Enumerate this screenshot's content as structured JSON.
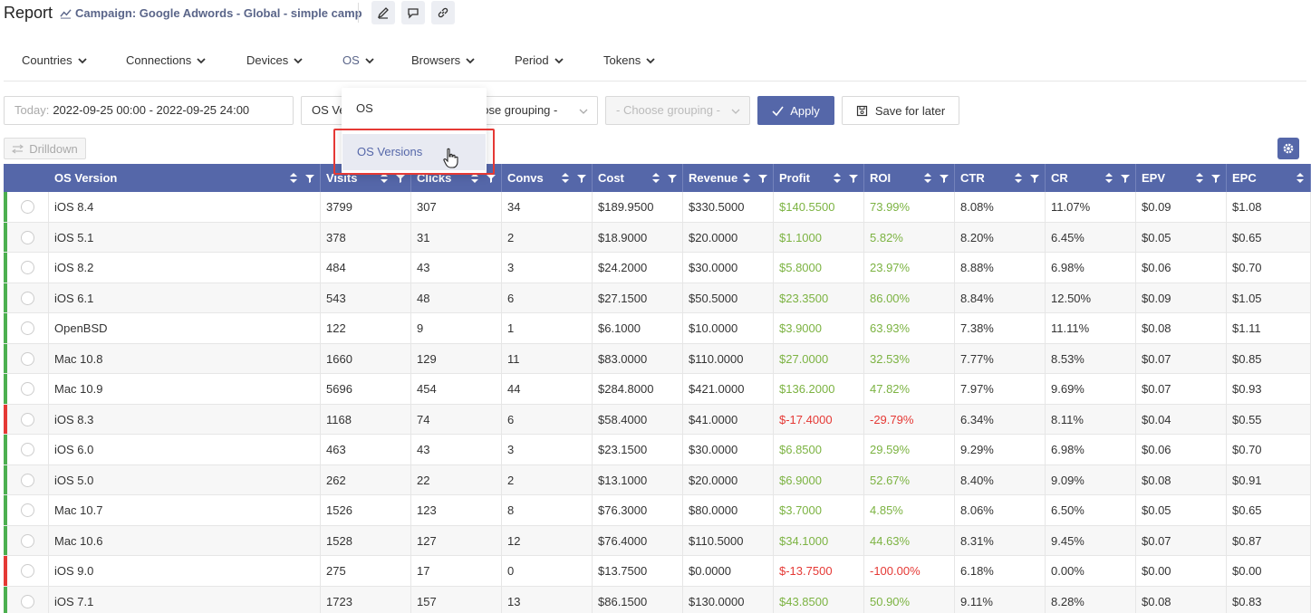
{
  "header": {
    "title": "Report",
    "campaign": "Campaign: Google Adwords - Global - simple camp",
    "buttons": [
      "edit-icon",
      "comment-icon",
      "link-icon"
    ]
  },
  "tabs": [
    {
      "label": "Countries",
      "active": false
    },
    {
      "label": "Connections",
      "active": false
    },
    {
      "label": "Devices",
      "active": false
    },
    {
      "label": "OS",
      "active": true
    },
    {
      "label": "Browsers",
      "active": false
    },
    {
      "label": "Period",
      "active": false
    },
    {
      "label": "Tokens",
      "active": false
    }
  ],
  "filters": {
    "date_label": "Today:",
    "date_value": "2022-09-25 00:00 - 2022-09-25 24:00",
    "grouping1": "OS Ve",
    "grouping2": "oose grouping -",
    "grouping3": "- Choose grouping -",
    "apply_label": "Apply",
    "save_label": "Save for later",
    "drilldown_label": "Drilldown"
  },
  "dropdown": {
    "items": [
      "OS",
      "OS Versions"
    ],
    "hovered": "OS Versions"
  },
  "table": {
    "columns": [
      "OS Version",
      "Visits",
      "Clicks",
      "Convs",
      "Cost",
      "Revenue",
      "Profit",
      "ROI",
      "CTR",
      "CR",
      "EPV",
      "EPC"
    ],
    "rows": [
      {
        "status": "green",
        "cells": [
          "iOS 8.4",
          "3799",
          "307",
          "34",
          "$189.9500",
          "$330.5000",
          "$140.5500",
          "73.99%",
          "8.08%",
          "11.07%",
          "$0.09",
          "$1.08"
        ]
      },
      {
        "status": "green",
        "cells": [
          "iOS 5.1",
          "378",
          "31",
          "2",
          "$18.9000",
          "$20.0000",
          "$1.1000",
          "5.82%",
          "8.20%",
          "6.45%",
          "$0.05",
          "$0.65"
        ]
      },
      {
        "status": "green",
        "cells": [
          "iOS 8.2",
          "484",
          "43",
          "3",
          "$24.2000",
          "$30.0000",
          "$5.8000",
          "23.97%",
          "8.88%",
          "6.98%",
          "$0.06",
          "$0.70"
        ]
      },
      {
        "status": "green",
        "cells": [
          "iOS 6.1",
          "543",
          "48",
          "6",
          "$27.1500",
          "$50.5000",
          "$23.3500",
          "86.00%",
          "8.84%",
          "12.50%",
          "$0.09",
          "$1.05"
        ]
      },
      {
        "status": "green",
        "cells": [
          "OpenBSD",
          "122",
          "9",
          "1",
          "$6.1000",
          "$10.0000",
          "$3.9000",
          "63.93%",
          "7.38%",
          "11.11%",
          "$0.08",
          "$1.11"
        ]
      },
      {
        "status": "green",
        "cells": [
          "Mac 10.8",
          "1660",
          "129",
          "11",
          "$83.0000",
          "$110.0000",
          "$27.0000",
          "32.53%",
          "7.77%",
          "8.53%",
          "$0.07",
          "$0.85"
        ]
      },
      {
        "status": "green",
        "cells": [
          "Mac 10.9",
          "5696",
          "454",
          "44",
          "$284.8000",
          "$421.0000",
          "$136.2000",
          "47.82%",
          "7.97%",
          "9.69%",
          "$0.07",
          "$0.93"
        ]
      },
      {
        "status": "red",
        "cells": [
          "iOS 8.3",
          "1168",
          "74",
          "6",
          "$58.4000",
          "$41.0000",
          "$-17.4000",
          "-29.79%",
          "6.34%",
          "8.11%",
          "$0.04",
          "$0.55"
        ]
      },
      {
        "status": "green",
        "cells": [
          "iOS 6.0",
          "463",
          "43",
          "3",
          "$23.1500",
          "$30.0000",
          "$6.8500",
          "29.59%",
          "9.29%",
          "6.98%",
          "$0.06",
          "$0.70"
        ]
      },
      {
        "status": "green",
        "cells": [
          "iOS 5.0",
          "262",
          "22",
          "2",
          "$13.1000",
          "$20.0000",
          "$6.9000",
          "52.67%",
          "8.40%",
          "9.09%",
          "$0.08",
          "$0.91"
        ]
      },
      {
        "status": "green",
        "cells": [
          "Mac 10.7",
          "1526",
          "123",
          "8",
          "$76.3000",
          "$80.0000",
          "$3.7000",
          "4.85%",
          "8.06%",
          "6.50%",
          "$0.05",
          "$0.65"
        ]
      },
      {
        "status": "green",
        "cells": [
          "Mac 10.6",
          "1528",
          "127",
          "12",
          "$76.4000",
          "$110.5000",
          "$34.1000",
          "44.63%",
          "8.31%",
          "9.45%",
          "$0.07",
          "$0.87"
        ]
      },
      {
        "status": "red",
        "cells": [
          "iOS 9.0",
          "275",
          "17",
          "0",
          "$13.7500",
          "$0.0000",
          "$-13.7500",
          "-100.00%",
          "6.18%",
          "0.00%",
          "$0.00",
          "$0.00"
        ]
      },
      {
        "status": "green",
        "cells": [
          "iOS 7.1",
          "1723",
          "157",
          "13",
          "$86.1500",
          "$130.0000",
          "$43.8500",
          "50.90%",
          "9.11%",
          "8.28%",
          "$0.08",
          "$0.83"
        ]
      }
    ]
  },
  "colors": {
    "accent": "#5567a9",
    "positive": "#7cb342",
    "negative": "#e53935",
    "status_green": "#4caf50",
    "status_red": "#e53935"
  }
}
